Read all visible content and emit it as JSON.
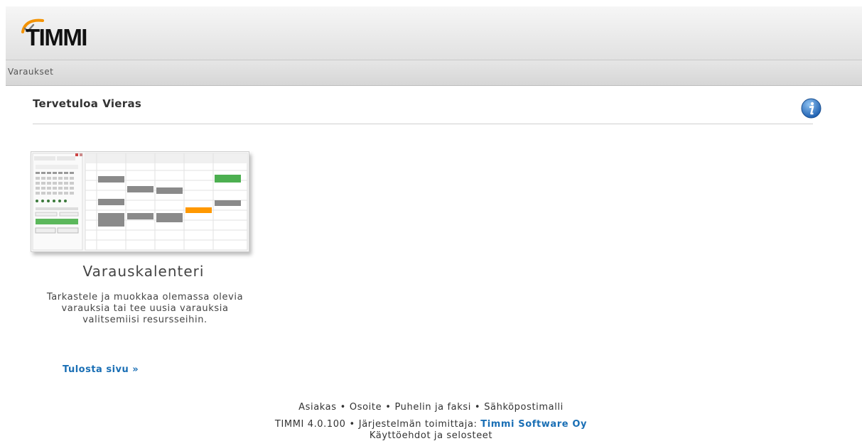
{
  "app": {
    "logo_text": "TIMMI",
    "brand_color": "#f39200"
  },
  "nav": {
    "items": [
      {
        "label": "Varaukset"
      }
    ]
  },
  "welcome": {
    "greeting": "Tervetuloa",
    "user": "Vieras"
  },
  "info_icon": "info-icon",
  "card": {
    "title": "Varauskalenteri",
    "description": "Tarkastele ja muokkaa olemassa olevia varauksia tai tee uusia varauksia valitsemiisi resursseihin."
  },
  "print_link": "Tulosta sivu »",
  "footer": {
    "links": [
      "Asiakas",
      "Osoite",
      "Puhelin ja faksi",
      "Sähköpostimalli"
    ],
    "separator": "•",
    "version": "TIMMI 4.0.100",
    "vendor_label": "Järjestelmän toimittaja:",
    "vendor": "Timmi Software Oy",
    "terms": "Käyttöehdot ja selosteet"
  },
  "colors": {
    "link": "#1a6fb5",
    "booking_gray": "#8a8a8a",
    "booking_green": "#4caf50",
    "booking_orange": "#ff9800"
  }
}
